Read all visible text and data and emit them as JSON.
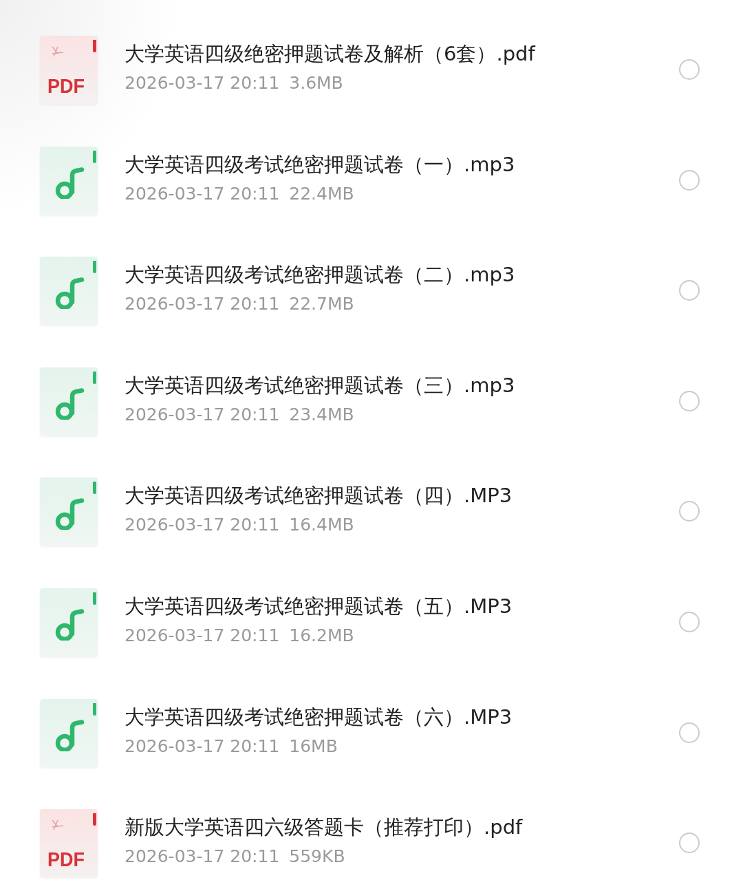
{
  "files": [
    {
      "kind": "pdf",
      "badge": "PDF",
      "name": "大学英语四级绝密押题试卷及解析（6套）.pdf",
      "time": "2026-03-17 20:11",
      "size": "3.6MB",
      "selected": false
    },
    {
      "kind": "audio",
      "name": "大学英语四级考试绝密押题试卷（一）.mp3",
      "time": "2026-03-17 20:11",
      "size": "22.4MB",
      "selected": false
    },
    {
      "kind": "audio",
      "name": "大学英语四级考试绝密押题试卷（二）.mp3",
      "time": "2026-03-17 20:11",
      "size": "22.7MB",
      "selected": false
    },
    {
      "kind": "audio",
      "name": "大学英语四级考试绝密押题试卷（三）.mp3",
      "time": "2026-03-17 20:11",
      "size": "23.4MB",
      "selected": false
    },
    {
      "kind": "audio",
      "name": "大学英语四级考试绝密押题试卷（四）.MP3",
      "time": "2026-03-17 20:11",
      "size": "16.4MB",
      "selected": false
    },
    {
      "kind": "audio",
      "name": "大学英语四级考试绝密押题试卷（五）.MP3",
      "time": "2026-03-17 20:11",
      "size": "16.2MB",
      "selected": false
    },
    {
      "kind": "audio",
      "name": "大学英语四级考试绝密押题试卷（六）.MP3",
      "time": "2026-03-17 20:11",
      "size": "16MB",
      "selected": false
    },
    {
      "kind": "pdf",
      "badge": "PDF",
      "name": "新版大学英语四六级答题卡（推荐打印）.pdf",
      "time": "2026-03-17 20:11",
      "size": "559KB",
      "selected": false
    }
  ]
}
